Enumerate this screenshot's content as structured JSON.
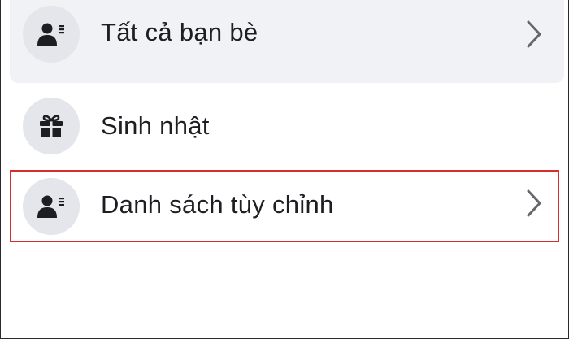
{
  "menu": {
    "items": [
      {
        "label": "Tất cả bạn bè",
        "icon": "friends-list-icon",
        "has_chevron": true,
        "selected": true
      },
      {
        "label": "Sinh nhật",
        "icon": "gift-icon",
        "has_chevron": false,
        "selected": false
      },
      {
        "label": "Danh sách tùy chỉnh",
        "icon": "custom-list-icon",
        "has_chevron": true,
        "selected": false,
        "highlighted": true
      }
    ]
  },
  "colors": {
    "selected_background": "#f0f2f5",
    "icon_circle": "#e4e6eb",
    "icon_glyph": "#1c1e21",
    "text": "#1c1e21",
    "chevron": "#65676b",
    "highlight_border": "#d32f2f"
  }
}
